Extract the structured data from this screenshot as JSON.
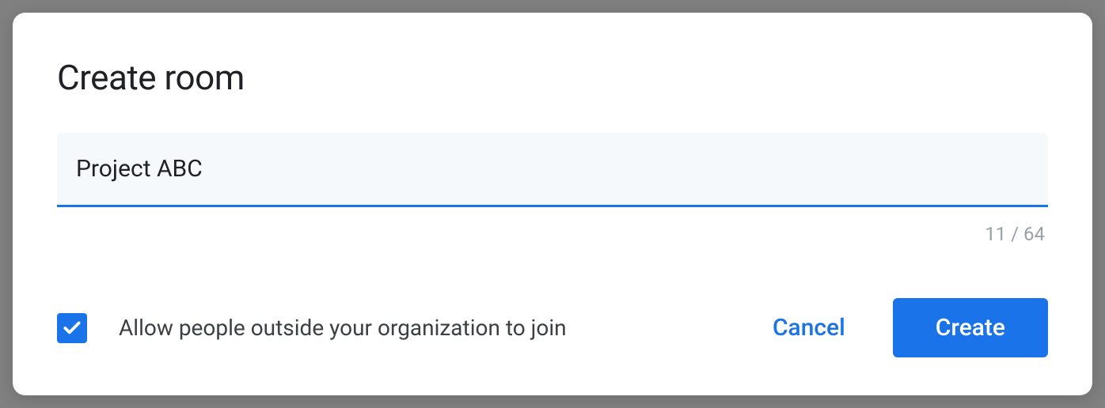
{
  "dialog": {
    "title": "Create room",
    "input": {
      "value": "Project ABC",
      "counter": "11 / 64"
    },
    "checkbox": {
      "label": "Allow people outside your organization to join",
      "checked": true
    },
    "buttons": {
      "cancel": "Cancel",
      "create": "Create"
    }
  }
}
